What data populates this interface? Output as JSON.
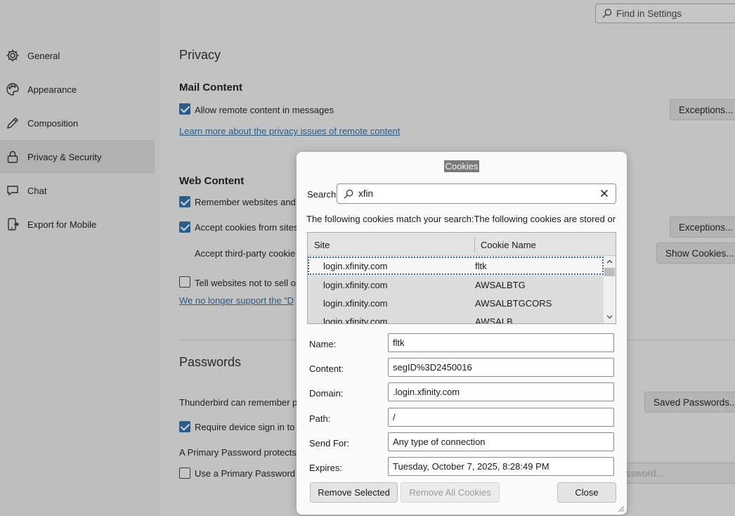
{
  "search_settings": {
    "placeholder": "Find in Settings"
  },
  "sidebar": {
    "items": [
      {
        "label": "General",
        "icon": "gear-icon"
      },
      {
        "label": "Appearance",
        "icon": "palette-icon"
      },
      {
        "label": "Composition",
        "icon": "pencil-icon"
      },
      {
        "label": "Privacy & Security",
        "icon": "lock-icon",
        "active": true
      },
      {
        "label": "Chat",
        "icon": "chat-icon"
      },
      {
        "label": "Export for Mobile",
        "icon": "mobile-export-icon"
      }
    ]
  },
  "main": {
    "privacy_heading": "Privacy",
    "mail_content": {
      "heading": "Mail Content",
      "allow_remote": "Allow remote content in messages",
      "allow_remote_checked": true,
      "learn_more": "Learn more about the privacy issues of remote content",
      "exceptions": "Exceptions..."
    },
    "web_content": {
      "heading": "Web Content",
      "remember": "Remember websites and",
      "remember_checked": true,
      "accept_cookies": "Accept cookies from sites",
      "accept_cookies_checked": true,
      "third_party": "Accept third-party cookie",
      "exceptions": "Exceptions...",
      "show_cookies": "Show Cookies...",
      "dnt": "Tell websites not to sell o",
      "dnt_checked": false,
      "dnt_link": "We no longer support the “D"
    },
    "passwords": {
      "heading": "Passwords",
      "remember": "Thunderbird can remember p",
      "saved_passwords": "Saved Passwords...",
      "device_signin": "Require device sign in to",
      "device_signin_checked": true,
      "primary_protects": "A Primary Password protects",
      "use_primary": "Use a Primary Password",
      "use_primary_checked": false,
      "change_primary": "Change Primary Password..."
    }
  },
  "dialog": {
    "title": "Cookies",
    "search_label": "Search:",
    "search_value": "xfin",
    "match_text": "The following cookies match your search:The following cookies are stored or",
    "columns": {
      "site": "Site",
      "cookie_name": "Cookie Name"
    },
    "rows": [
      {
        "site": "login.xfinity.com",
        "name": "fltk",
        "selected": true
      },
      {
        "site": "login.xfinity.com",
        "name": "AWSALBTG"
      },
      {
        "site": "login.xfinity.com",
        "name": "AWSALBTGCORS"
      },
      {
        "site": "login.xfinity.com",
        "name": "AWSALB"
      }
    ],
    "fields": {
      "name_label": "Name:",
      "name_value": "fltk",
      "content_label": "Content:",
      "content_value": "segID%3D2450016",
      "domain_label": "Domain:",
      "domain_value": ".login.xfinity.com",
      "path_label": "Path:",
      "path_value": "/",
      "sendfor_label": "Send For:",
      "sendfor_value": "Any type of connection",
      "expires_label": "Expires:",
      "expires_value": "Tuesday, October 7, 2025, 8:28:49 PM"
    },
    "buttons": {
      "remove_selected": "Remove Selected",
      "remove_all": "Remove All Cookies",
      "close": "Close"
    }
  }
}
